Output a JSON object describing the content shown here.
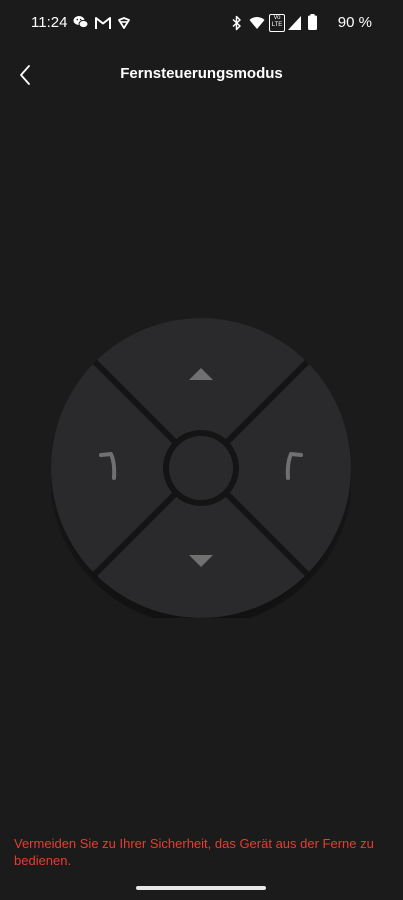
{
  "status_bar": {
    "time": "11:24",
    "battery": "90 %",
    "left_icons": [
      "wechat-icon",
      "gmail-icon",
      "app-icon"
    ],
    "right_icons": [
      "bluetooth-icon",
      "wifi-icon",
      "volte-icon",
      "signal-icon",
      "battery-icon"
    ],
    "volte_label_top": "Vo",
    "volte_label_bottom": "LTE"
  },
  "header": {
    "title": "Fernsteuerungsmodus",
    "back_icon": "chevron-left-icon"
  },
  "remote_control": {
    "buttons": [
      "forward-button",
      "backward-button",
      "turn-left-button",
      "turn-right-button",
      "center-button"
    ],
    "pad_color": "#2a2a2c",
    "divider_color": "#141414",
    "arrow_color": "#707070"
  },
  "footer": {
    "warning": "Vermeiden Sie zu Ihrer Sicherheit, das Gerät aus der Ferne zu bedienen.",
    "warning_color": "#e53e2f"
  }
}
